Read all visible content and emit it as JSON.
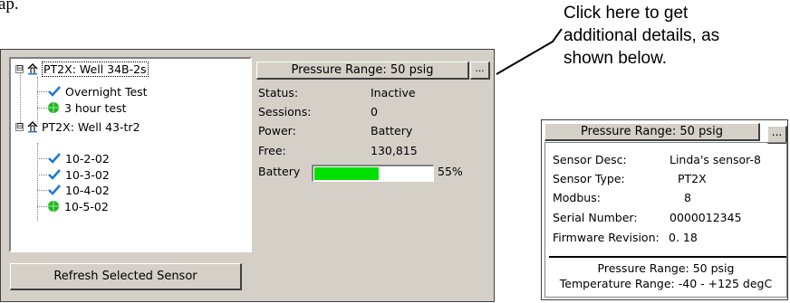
{
  "intro_fragment": "ap.",
  "callout": {
    "lines": [
      "Click here to get",
      "additional details, as",
      "shown below."
    ]
  },
  "tree": {
    "sensors": [
      {
        "label": "PT2X: Well 34B-2s",
        "expander": "⊟",
        "sessions": [
          {
            "label": "Overnight Test",
            "status_icon": "check-icon"
          },
          {
            "label": "3 hour test",
            "status_icon": "green-dot-icon"
          }
        ]
      },
      {
        "label": "PT2X: Well 43-tr2",
        "expander": "⊟",
        "sessions": [
          {
            "label": "10-2-02",
            "status_icon": "check-icon"
          },
          {
            "label": "10-3-02",
            "status_icon": "check-icon"
          },
          {
            "label": "10-4-02",
            "status_icon": "check-icon"
          },
          {
            "label": "10-5-02",
            "status_icon": "green-dot-icon"
          }
        ]
      }
    ]
  },
  "refresh_button": "Refresh Selected Sensor",
  "sensor_panel": {
    "range_button": "Pressure Range: 50 psig",
    "more_button": "...",
    "status_label": "Status:",
    "status_value": "Inactive",
    "sessions_label": "Sessions:",
    "sessions_value": "0",
    "power_label": "Power:",
    "power_value": "Battery",
    "free_label": "Free:",
    "free_value": "130,815",
    "battery_label": "Battery",
    "battery_percent_text": "55%",
    "battery_level": 0.55,
    "battery_color": "#00e000"
  },
  "detail_panel": {
    "range_button": "Pressure Range: 50 psig",
    "more_button": "...",
    "sensor_desc_label": "Sensor Desc:",
    "sensor_desc_value": "Linda's sensor-8",
    "sensor_type_label": "Sensor Type:",
    "sensor_type_value": "PT2X",
    "modbus_label": "Modbus:",
    "modbus_value": "8",
    "serial_label": "Serial Number:",
    "serial_value": "0000012345",
    "firmware_label": "Firmware Revision:",
    "firmware_value": "0. 18",
    "pressure_range_text": "Pressure Range: 50 psig",
    "temperature_range_text": "Temperature Range: -40 - +125 degC"
  },
  "colors": {
    "dialog_bg": "#d4d0c8",
    "check": "#1e78d8",
    "dot": "#22b422"
  }
}
